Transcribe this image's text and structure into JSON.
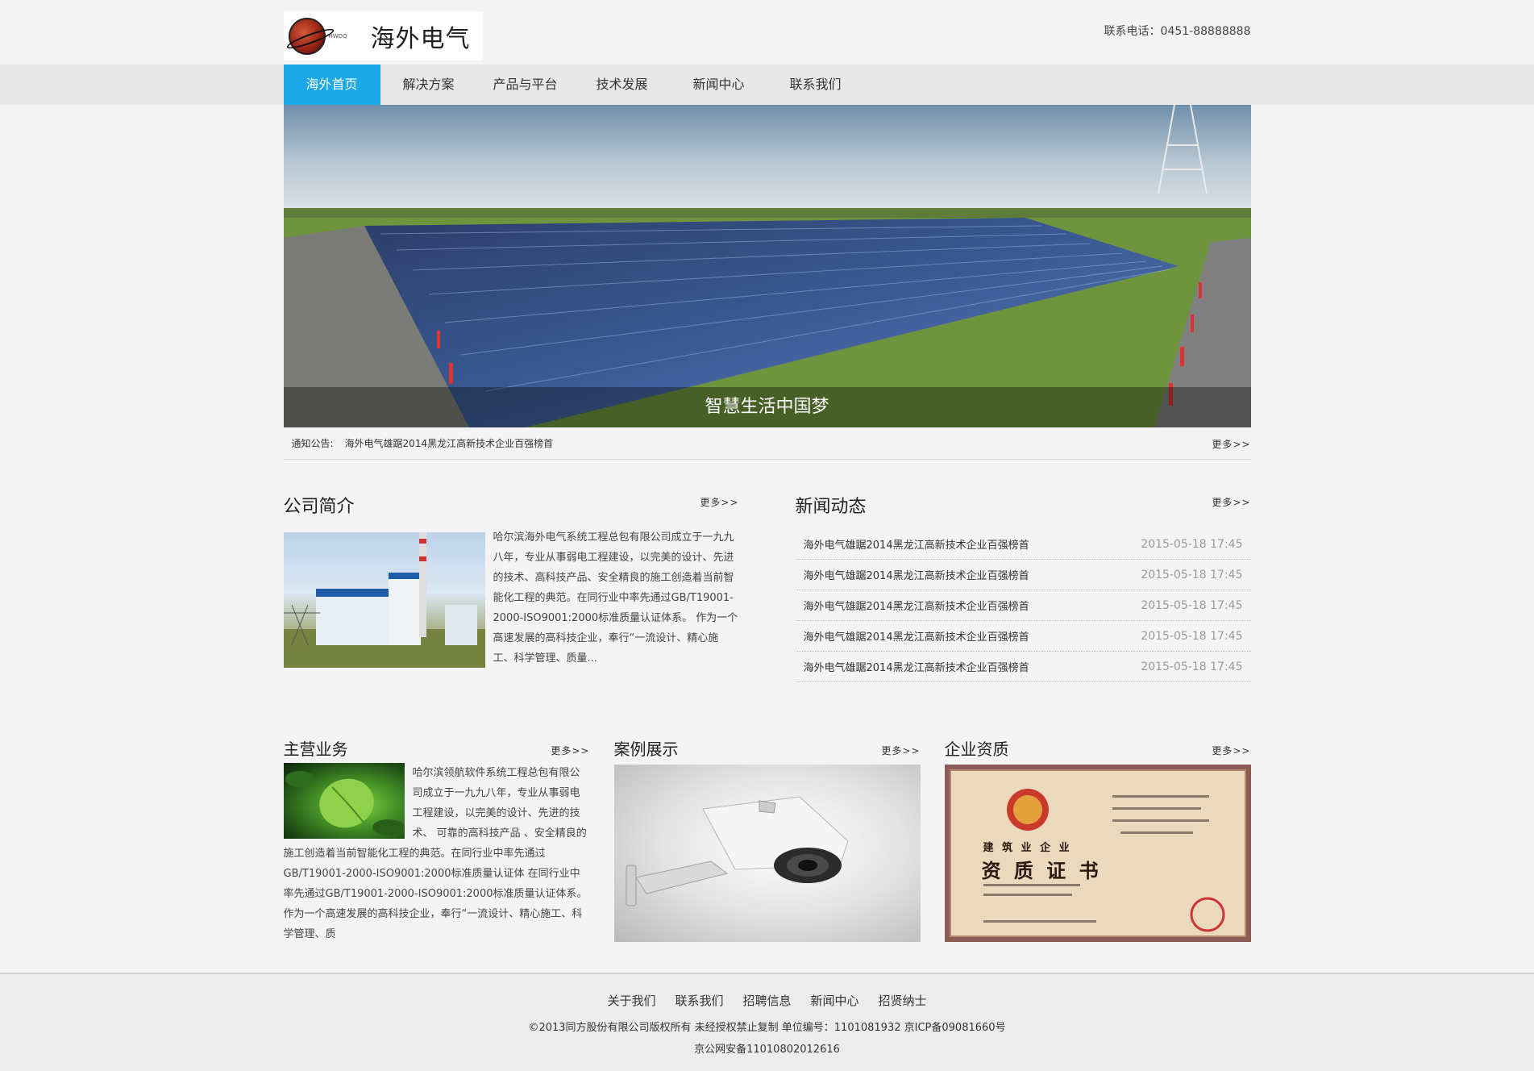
{
  "header": {
    "logo_text": "海外电气",
    "logo_sub": "HWDQ",
    "phone": "联系电话：0451-88888888"
  },
  "nav": {
    "items": [
      {
        "label": "海外首页",
        "active": true
      },
      {
        "label": "解决方案",
        "active": false
      },
      {
        "label": "产品与平台",
        "active": false
      },
      {
        "label": "技术发展",
        "active": false
      },
      {
        "label": "新闻中心",
        "active": false
      },
      {
        "label": "联系我们",
        "active": false
      }
    ]
  },
  "banner": {
    "caption": "智慧生活中国梦"
  },
  "notice": {
    "label": "通知公告:",
    "text": "海外电气雄踞2014黑龙江高新技术企业百强榜首",
    "more": "更多>>"
  },
  "about": {
    "title": "公司简介",
    "more": "更多>>",
    "text": "哈尔滨海外电气系统工程总包有限公司成立于一九九八年，专业从事弱电工程建设，以完美的设计、先进的技术、高科技产品、安全精良的施工创造着当前智能化工程的典范。在同行业中率先通过GB/T19001-2000-ISO9001:2000标准质量认证体系。 作为一个高速发展的高科技企业，奉行“一流设计、精心施工、科学管理、质量..."
  },
  "news": {
    "title": "新闻动态",
    "more": "更多>>",
    "items": [
      {
        "title": "海外电气雄踞2014黑龙江高新技术企业百强榜首",
        "date": "2015-05-18 17:45"
      },
      {
        "title": "海外电气雄踞2014黑龙江高新技术企业百强榜首",
        "date": "2015-05-18 17:45"
      },
      {
        "title": "海外电气雄踞2014黑龙江高新技术企业百强榜首",
        "date": "2015-05-18 17:45"
      },
      {
        "title": "海外电气雄踞2014黑龙江高新技术企业百强榜首",
        "date": "2015-05-18 17:45"
      },
      {
        "title": "海外电气雄踞2014黑龙江高新技术企业百强榜首",
        "date": "2015-05-18 17:45"
      }
    ]
  },
  "business": {
    "title": "主营业务",
    "more": "更多>>",
    "text": "哈尔滨领航软件系统工程总包有限公司成立于一九九八年，专业从事弱电工程建设，以完美的设计、先进的技术、 可靠的高科技产品 、安全精良的施工创造着当前智能化工程的典范。在同行业中率先通过GB/T19001-2000-ISO9001:2000标准质量认证体 在同行业中率先通过GB/T19001-2000-ISO9001:2000标准质量认证体系。 作为一个高速发展的高科技企业，奉行“一流设计、精心施工、科学管理、质"
  },
  "cases": {
    "title": "案例展示",
    "more": "更多>>"
  },
  "qualification": {
    "title": "企业资质",
    "more": "更多>>",
    "cert_line1": "建 筑 业 企 业",
    "cert_line2": "资 质 证 书"
  },
  "footer": {
    "links": [
      "关于我们",
      "联系我们",
      "招聘信息",
      "新闻中心",
      "招贤纳士"
    ],
    "copyright": "©2013同方股份有限公司版权所有 未经授权禁止复制 单位编号：1101081932 京ICP备09081660号",
    "icp": "京公网安备11010802012616"
  },
  "colors": {
    "accent": "#1ba8e8",
    "background": "#f4f4f4",
    "nav_bg": "#e8e8e8"
  }
}
